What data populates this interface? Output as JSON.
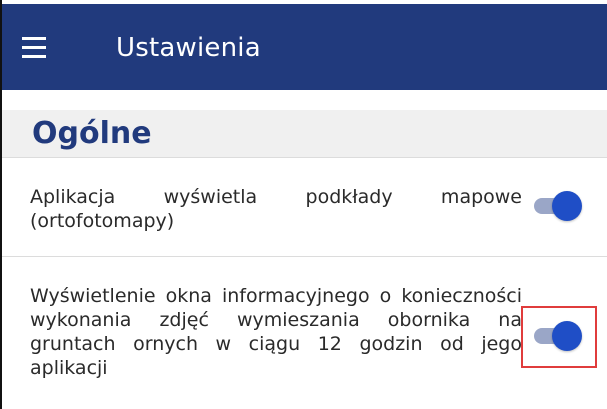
{
  "app_bar": {
    "title": "Ustawienia",
    "menu_icon": "hamburger-menu-icon",
    "background": "#213a7d"
  },
  "section": {
    "title": "Ogólne",
    "title_color": "#213a7d"
  },
  "settings": [
    {
      "label": "Aplikacja wyświetla podkłady mapowe (ortofotomapy)",
      "enabled": true
    },
    {
      "label": "Wyświetlenie okna informacyjnego o konieczności wykonania zdjęć wymieszania obornika na gruntach ornych w ciągu 12 godzin od jego aplikacji",
      "enabled": true
    }
  ],
  "colors": {
    "toggle_on_thumb": "#1f4ec6",
    "toggle_on_track": "#9aa6c7",
    "highlight": "#e03c3c"
  }
}
